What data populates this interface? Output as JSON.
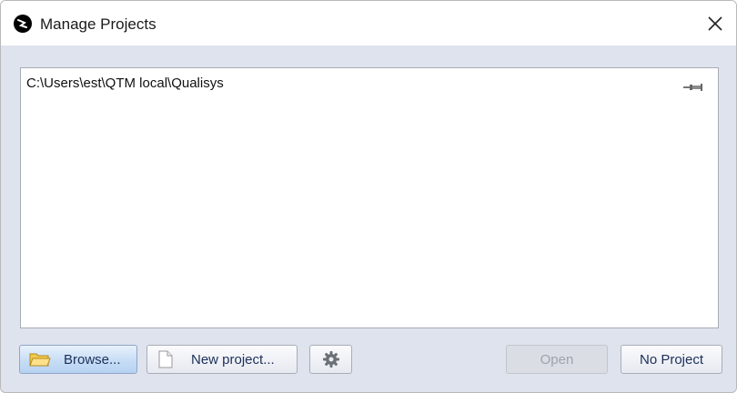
{
  "window": {
    "title": "Manage Projects",
    "icons": {
      "app": "qualisys-logo-icon",
      "close": "close-icon"
    }
  },
  "projects": {
    "items": [
      {
        "path": "C:\\Users\\est\\QTM local\\Qualisys",
        "icon": "pin-icon"
      }
    ]
  },
  "buttons": {
    "browse": {
      "label": "Browse...",
      "icon": "folder-icon"
    },
    "new_project": {
      "label": "New project...",
      "icon": "document-icon"
    },
    "settings": {
      "icon": "gear-icon"
    },
    "open": {
      "label": "Open",
      "enabled": false
    },
    "no_project": {
      "label": "No Project"
    }
  },
  "colors": {
    "dialog_background": "#dfe3ee",
    "browse_highlight": "#c7ddf5",
    "disabled_text": "#9ea3ad",
    "button_text": "#1c2f5a"
  }
}
